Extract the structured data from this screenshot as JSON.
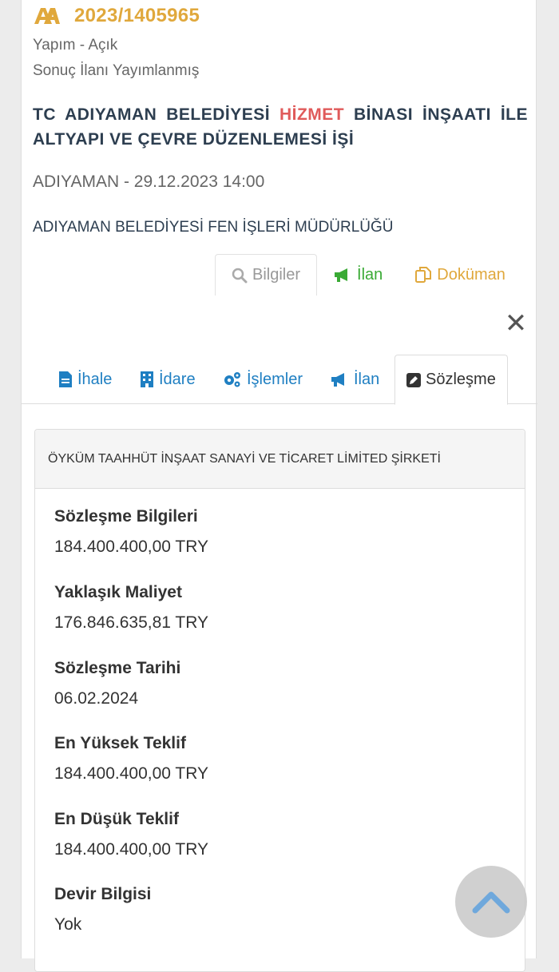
{
  "header": {
    "tender_no": "2023/1405965",
    "type_status": "Yapım - Açık",
    "result_status": "Sonuç İlanı Yayımlanmış",
    "title_part1": "TC ADIYAMAN BELEDİYESİ ",
    "title_highlight": "HİZMET",
    "title_part2": " BİNASI İNŞAATI İLE ALTYAPI VE ÇEVRE DÜZENLEMESİ İŞİ",
    "location_date": "ADIYAMAN - 29.12.2023 14:00",
    "organization": "ADIYAMAN BELEDİYESİ FEN İŞLERİ MÜDÜRLÜĞÜ"
  },
  "top_tabs": {
    "bilgiler": "Bilgiler",
    "ilan": "İlan",
    "dokuman": "Doküman"
  },
  "close_label": "✕",
  "sub_tabs": {
    "ihale": "İhale",
    "idare": "İdare",
    "islemler": "İşlemler",
    "ilan": "İlan",
    "sozlesme": "Sözleşme"
  },
  "contract": {
    "company": "ÖYKÜM TAAHHÜT İNŞAAT SANAYİ VE TİCARET LİMİTED ŞİRKETİ",
    "fields": [
      {
        "label": "Sözleşme Bilgileri",
        "value": "184.400.400,00 TRY"
      },
      {
        "label": "Yaklaşık Maliyet",
        "value": "176.846.635,81 TRY"
      },
      {
        "label": "Sözleşme Tarihi",
        "value": "06.02.2024"
      },
      {
        "label": "En Yüksek Teklif",
        "value": "184.400.400,00 TRY"
      },
      {
        "label": "En Düşük Teklif",
        "value": "184.400.400,00 TRY"
      },
      {
        "label": "Devir Bilgisi",
        "value": "Yok"
      }
    ]
  },
  "colors": {
    "accent_gold": "#e0a83c",
    "highlight_red": "#e05a5a",
    "title_navy": "#2d3e50",
    "link_blue": "#1f7fc2",
    "green": "#3aaa35"
  }
}
